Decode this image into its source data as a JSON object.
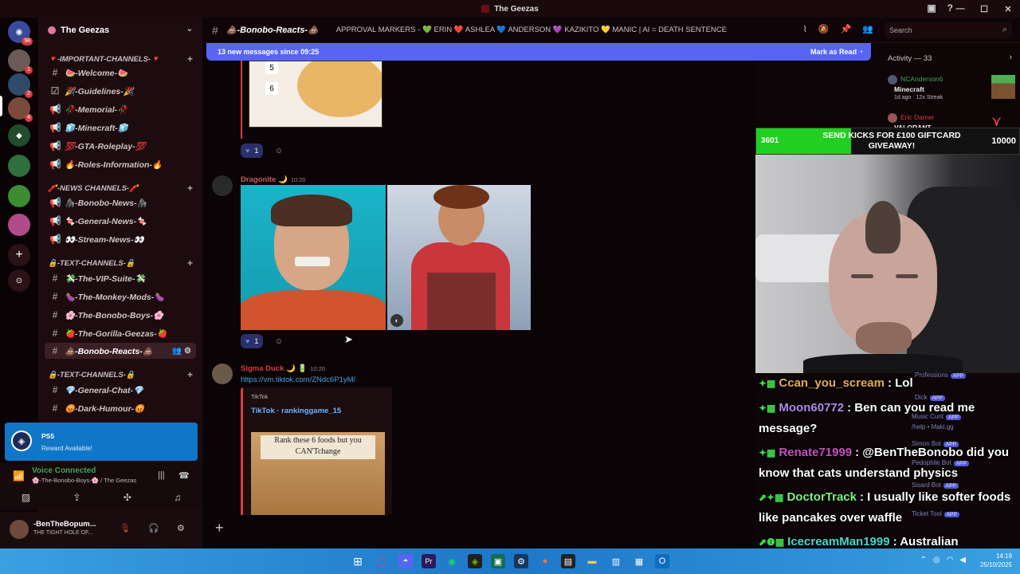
{
  "window": {
    "title": "The Geezas",
    "controls": [
      "—",
      "☐",
      "✕"
    ],
    "header_icons": [
      "monitor-icon",
      "help-icon"
    ]
  },
  "rail": {
    "badges": [
      "98",
      "1",
      "2",
      "4"
    ]
  },
  "sidebar": {
    "guild_name": "The Geezas",
    "categories": [
      {
        "label": "🔻-IMPORTANT-CHANNELS-🔻",
        "channels": [
          {
            "label": "🍉-Welcome-🍉"
          },
          {
            "label": "🎉-Guidelines-🎉"
          },
          {
            "label": "🥀-Memorial-🥀"
          },
          {
            "label": "🧊-Minecraft-🧊"
          },
          {
            "label": "💯-GTA-Roleplay-💯"
          },
          {
            "label": "🔥-Roles-Information-🔥"
          }
        ]
      },
      {
        "label": "🧨-NEWS CHANNELS-🧨",
        "channels": [
          {
            "label": "🦍-Bonobo-News-🦍"
          },
          {
            "label": "🍬-General-News-🍬"
          },
          {
            "label": "👀-Stream-News-👀"
          }
        ]
      },
      {
        "label": "🔒-TEXT-CHANNELS-🔒",
        "channels": [
          {
            "label": "💸-The-VIP-Suite-💸"
          },
          {
            "label": "🍆-The-Monkey-Mods-🍆"
          },
          {
            "label": "🌸-The-Bonobo-Boys-🌸"
          },
          {
            "label": "🍓-The-Gorilla-Geezas-🍓"
          },
          {
            "label": "💩-Bonobo-Reacts-💩"
          }
        ]
      },
      {
        "label": "🔒-TEXT-CHANNELS-🔒",
        "channels": [
          {
            "label": "💎-General-Chat-💎"
          },
          {
            "label": "😡-Dark-Humour-😡"
          }
        ]
      }
    ]
  },
  "promo": {
    "title": "PS5",
    "subtitle": "Reward Available!"
  },
  "voice": {
    "status": "Voice Connected",
    "channel": "🌸-The-Bonobo-Boys-🌸 / The Geezas"
  },
  "user": {
    "name": "-BenTheBopum...",
    "status": "THE TIGHT HOLE OF..."
  },
  "channel_header": {
    "name": "💩-Bonobo-Reacts-💩",
    "topic": "APPROVAL MARKERS - 💚 ERIN ❤️ ASHLEA 💙 ANDERSON 💜 KAZIKITO 💛 MANIC | AI = DEATH SENTENCE",
    "search_placeholder": "Search"
  },
  "new_messages": {
    "text": "13 new messages since 09:25",
    "action": "Mark as Read"
  },
  "messages": [
    {
      "ranks": [
        "5",
        "6"
      ],
      "reaction_count": "1"
    },
    {
      "author": "Dragonite 🌙",
      "time": "10:20",
      "reaction_count": "1",
      "author_color": "#c75b5b"
    },
    {
      "author": "Sigma Duck 🌙 🔋",
      "time": "10:20",
      "link": "https://vm.tiktok.com/ZNdc6P1yM/",
      "author_color": "#d83c3e",
      "embed": {
        "provider": "TikTok",
        "title": "TikTok · rankinggame_15",
        "image_caption": "Rank these 6 foods but you CAN'Tchange"
      }
    }
  ],
  "activity": {
    "title": "Activity — 33",
    "items": [
      {
        "name": "NCAnderson6",
        "game": "Minecraft",
        "meta": "1d ago · 12x Streak"
      },
      {
        "name": "Eric Damer",
        "game": "VALORANT"
      }
    ]
  },
  "overlay": {
    "current": "3601",
    "goal_text": "SEND KICKS FOR £100 GIFTCARD GIVEAWAY!",
    "goal": "10000",
    "progress": 0.36
  },
  "chat": [
    {
      "user": "Ccan_you_scream",
      "color": "#e0b04a",
      "message": ": Lol"
    },
    {
      "user": "Moon60772",
      "color": "#b08ae8",
      "message": ": Ben can you read me message?"
    },
    {
      "user": "Renate71999",
      "color": "#c64ec0",
      "message": ": @BenTheBonobo did you know that cats understand physics"
    },
    {
      "user": "DoctorTrack",
      "color": "#7cf07c",
      "message": ": I usually like softer foods like pancakes over waffle"
    },
    {
      "user": "IcecreamMan1999",
      "color": "#46d8c8",
      "message": ": Australian oppressive state"
    }
  ],
  "member_ghosts": [
    "Professions",
    "Dick",
    "Music Cunt",
    "/help • Maki.gg",
    "Simon Bot",
    "Pedophile Bot",
    "Sisard Bot",
    "Ticket Tool"
  ],
  "taskbar": {
    "time": "14:19",
    "date": "25/10/2025"
  },
  "colors": {
    "accent": "#5865f2",
    "sidebar": "#1c0b0f",
    "online": "#3ba55d",
    "danger": "#d83c3e"
  }
}
